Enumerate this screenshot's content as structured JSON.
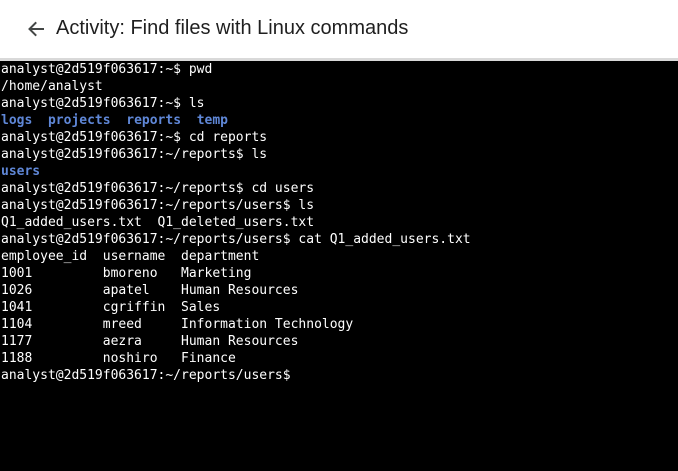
{
  "header": {
    "back_icon": "arrow-left-icon",
    "title": "Activity: Find files with Linux commands"
  },
  "colors": {
    "terminal_bg": "#000000",
    "terminal_text": "#ffffff",
    "directory_text": "#5f87d7"
  },
  "terminal": {
    "lines": [
      "analyst@2d519f063617:~$ pwd",
      "/home/analyst",
      "analyst@2d519f063617:~$ ls",
      {
        "dirs": [
          "logs",
          "projects",
          "reports",
          "temp"
        ]
      },
      "analyst@2d519f063617:~$ cd reports",
      "analyst@2d519f063617:~/reports$ ls",
      {
        "dirs": [
          "users"
        ]
      },
      "analyst@2d519f063617:~/reports$ cd users",
      "analyst@2d519f063617:~/reports/users$ ls",
      "Q1_added_users.txt  Q1_deleted_users.txt",
      "analyst@2d519f063617:~/reports/users$ cat Q1_added_users.txt",
      "employee_id  username  department",
      "1001         bmoreno   Marketing",
      "1026         apatel    Human Resources",
      "1041         cgriffin  Sales",
      "1104         mreed     Information Technology",
      "1177         aezra     Human Resources",
      "1188         noshiro   Finance",
      "analyst@2d519f063617:~/reports/users$ "
    ]
  }
}
